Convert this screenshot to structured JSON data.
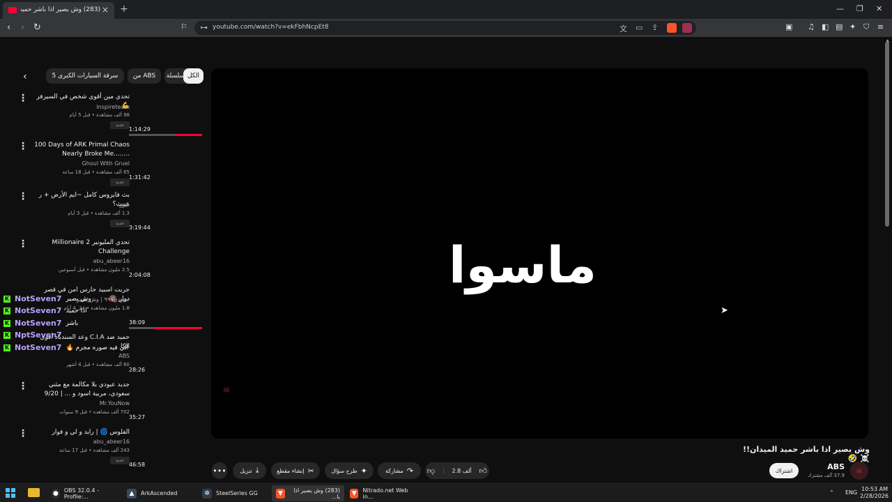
{
  "browser": {
    "tab_title": "(283) وش يصير اذا باشر حميد المدان",
    "url": "youtube.com/watch?v=ekFbhNcpEt8"
  },
  "chips": [
    "الكل",
    "من السلسلة",
    "من ABS",
    "سرقة السيارات الكبرى 5"
  ],
  "videos": [
    {
      "title": "تحدي مين أقوى شخص في السيرفر 💪",
      "channel": "Inspireteam",
      "meta": "98 ألف مشاهدة • قبل 5 أيام",
      "badge": "جديد",
      "duration": "1:14:29",
      "progress": 0.35
    },
    {
      "title": "100 Days of ARK Primal Chaos Nearly Broke Me........",
      "channel": "Ghoul With Gruel",
      "meta": "65 ألف مشاهدة • قبل 18 ساعة",
      "badge": "جديد",
      "duration": "1:31:42",
      "progress": 0
    },
    {
      "title": "بث فايروس كامل ~ايم الأرض + ر عبيب؟",
      "channel": "فيروا",
      "meta": "1.3 ألف مشاهدة • قبل 3 أيام",
      "badge": "جديد",
      "duration": "3:19:44",
      "progress": 0
    },
    {
      "title": "تحدي المليونير 2 Millionaire Challenge",
      "channel": "abu_abeer16",
      "meta": "2.5 مليون مشاهدة • قبل أسبوعين",
      "badge": "",
      "duration": "2:04:08",
      "progress": 0
    },
    {
      "title": "جربت اسبيد حارس امن في قصر دوار 🔞",
      "channel": "حمودي٩٩٩ | وش يصير",
      "meta": "1.8 مليون مشاهدة • قبل 4 أيام",
      "badge": "",
      "duration": "38:09",
      "progress": 0.65
    },
    {
      "title": "حميد ضد C.I.A وعد السندباد أقوى الكا",
      "channel": "ABS",
      "meta": "60 ألف مشاهدة • قبل 4 أشهر",
      "badge": "",
      "duration": "28:26",
      "progress": 0
    },
    {
      "title": "جديد عبودي بلا مكالمة مع مثني سعودي، مربية اسود و ... | 9/20",
      "channel": "Mr.YouNow",
      "meta": "702 ألف مشاهدة • قبل 9 سنوات",
      "badge": "",
      "duration": "35:27",
      "progress": 0
    },
    {
      "title": "الفلوس 🌀 | رايد و لي و فوار",
      "channel": "abu_abeer16",
      "meta": "243 ألف مشاهدة • قبل 17 ساعة",
      "badge": "جديد",
      "duration": "46:58",
      "progress": 0
    }
  ],
  "chat": [
    {
      "name": "NotSeven7",
      "msg": "وش يصير"
    },
    {
      "name": "NotSeven7",
      "msg": "اذا حميد"
    },
    {
      "name": "NotSeven7",
      "msg": "باشر"
    },
    {
      "name": "NptSeven7",
      "msg": ""
    },
    {
      "name": "NotSeven7",
      "msg": "الي فيه صوره مجرم 🔥"
    }
  ],
  "player": {
    "overlay_text": "ماسوا"
  },
  "video": {
    "title": "وش يصير اذا باشر حميد الميدان!! ☠️ 🤣",
    "channel": "ABS",
    "subscribers": "37.9 ألف مشترك",
    "subscribe_label": "اشتراك",
    "likes": "2.8 ألف",
    "share_label": "مشاركة",
    "ask_label": "طرح سؤال",
    "clip_label": "إنشاء مقطع",
    "download_label": "تنزيل"
  },
  "taskbar": {
    "items": [
      "OBS 32.0.4 - Profile:...",
      "ArkAscended",
      "SteelSeries GG",
      "(283) وش يصير اذا با...",
      "Nitrado.net Web in..."
    ],
    "lang": "ENG",
    "time": "10:53 AM",
    "date": "2/28/2026"
  },
  "colors": {
    "accent": "#ff0033",
    "kick": "#53fc18",
    "chat_name": "#b9a3ff"
  }
}
